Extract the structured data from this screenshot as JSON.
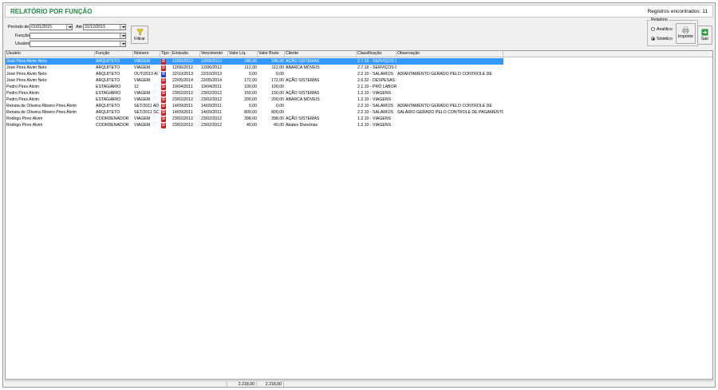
{
  "header": {
    "title": "RELATÓRIO POR FUNÇÃO",
    "records_found": "Registros encontrados: 11"
  },
  "filters": {
    "period_label": "Período de",
    "date_from": "01/01/2015",
    "until_label": "Até",
    "date_to": "31/12/2015",
    "function_label": "Função",
    "function_value": "",
    "user_label": "Usuário",
    "user_value": "",
    "filter_button": "Filtrar"
  },
  "report": {
    "legend": "Relatório",
    "options": [
      "Analítico",
      "Sintético"
    ],
    "selected": "Sintético",
    "print_button": "Imprimir",
    "exit_button": "Sair"
  },
  "colors": {
    "title_green": "#1e8a3e",
    "selection_blue": "#3399ff",
    "type_d": "#cc1f1f",
    "type_r": "#1f3fcc"
  },
  "table": {
    "columns": [
      "Usuário",
      "Função",
      "Número",
      "Tipo",
      "Emissão",
      "Vencimento",
      "Valor Líq.",
      "Valor Bruto",
      "Cliente",
      "Classificação",
      "Observação"
    ],
    "sort_indicator": "/",
    "rows": [
      {
        "usuario": "José Pires Alvim Neto",
        "funcao": "ARQUITETO",
        "numero": "VIAGEM",
        "tipo": "D",
        "emissao": "12/06/2012",
        "vencimento": "12/06/2012",
        "liq": "246,00",
        "bruto": "246,00",
        "cliente": "AÇÃO SISTEMAS",
        "classificacao": "2.7.16 - SERVIÇOS D",
        "observacao": "",
        "selected": true
      },
      {
        "usuario": "José Pires Alvim Neto",
        "funcao": "ARQUITETO",
        "numero": "VIAGEM",
        "tipo": "D",
        "emissao": "12/06/2012",
        "vencimento": "12/06/2012",
        "liq": "112,00",
        "bruto": "112,00",
        "cliente": "ABARCA MÓVEIS",
        "classificacao": "2.7.16 - SERVIÇOS D",
        "observacao": "",
        "selected": false
      },
      {
        "usuario": "José Pires Alvim Neto",
        "funcao": "ARQUITETO",
        "numero": "OUT/2013 Al",
        "tipo": "R",
        "emissao": "22/10/2013",
        "vencimento": "22/10/2013",
        "liq": "0,00",
        "bruto": "0,00",
        "cliente": "",
        "classificacao": "2.2.10 - SALÁRIOS",
        "observacao": "ADIANTAMENTO GERADO PELO CONTROLE DE",
        "selected": false
      },
      {
        "usuario": "José Pires Alvim Neto",
        "funcao": "ARQUITETO",
        "numero": "VIAGEM",
        "tipo": "D",
        "emissao": "22/05/2014",
        "vencimento": "22/05/2014",
        "liq": "172,00",
        "bruto": "172,00",
        "cliente": "AÇÃO SISTEMAS",
        "classificacao": "2.6.32 - DESPESAS C",
        "observacao": "",
        "selected": false
      },
      {
        "usuario": "Pedro Pires Alvim",
        "funcao": "ESTAGIÁRIO",
        "numero": "12",
        "tipo": "D",
        "emissao": "19/04/2011",
        "vencimento": "19/04/2011",
        "liq": "100,00",
        "bruto": "100,00",
        "cliente": "",
        "classificacao": "2.1.10 - PRÓ LABORE",
        "observacao": "",
        "selected": false
      },
      {
        "usuario": "Pedro Pires Alvim",
        "funcao": "ESTAGIÁRIO",
        "numero": "VIAGEM",
        "tipo": "D",
        "emissao": "23/02/2012",
        "vencimento": "23/02/2012",
        "liq": "150,00",
        "bruto": "150,00",
        "cliente": "AÇÃO SISTEMAS",
        "classificacao": "1.2.10 - VIAGENS",
        "observacao": "",
        "selected": false
      },
      {
        "usuario": "Pedro Pires Alvim",
        "funcao": "ESTAGIÁRIO",
        "numero": "VIAGEM",
        "tipo": "D",
        "emissao": "23/02/2012",
        "vencimento": "23/02/2012",
        "liq": "200,00",
        "bruto": "200,00",
        "cliente": "ABARCA MÓVEIS",
        "classificacao": "1.2.10 - VIAGENS",
        "observacao": "",
        "selected": false
      },
      {
        "usuario": "Renata de Oliveira Ribeiro Pires Alvim",
        "funcao": "ARQUITETO",
        "numero": "SET/2011 AD",
        "tipo": "D",
        "emissao": "14/09/2011",
        "vencimento": "14/09/2011",
        "liq": "0,00",
        "bruto": "0,00",
        "cliente": "",
        "classificacao": "2.2.10 - SALÁRIOS",
        "observacao": "ADIANTAMENTO GERADO PELO CONTROLE DE",
        "selected": false
      },
      {
        "usuario": "Renata de Oliveira Ribeiro Pires Alvim",
        "funcao": "ARQUITETO",
        "numero": "SET/2011 SC",
        "tipo": "D",
        "emissao": "14/09/2011",
        "vencimento": "14/09/2011",
        "liq": "800,00",
        "bruto": "800,00",
        "cliente": "",
        "classificacao": "2.2.10 - SALÁRIOS",
        "observacao": "SALÁRIO GERADO PELO CONTROLE DE PAGAMENTO",
        "selected": false
      },
      {
        "usuario": "Rodrigo Pires Alvim",
        "funcao": "COORDENADOR",
        "numero": "VIAGEM",
        "tipo": "D",
        "emissao": "23/02/2012",
        "vencimento": "23/02/2012",
        "liq": "398,00",
        "bruto": "398,00",
        "cliente": "AÇÃO SISTEMAS",
        "classificacao": "1.2.10 - VIAGENS",
        "observacao": "",
        "selected": false
      },
      {
        "usuario": "Rodrigo Pires Alvim",
        "funcao": "COORDENADOR",
        "numero": "VIAGEM",
        "tipo": "D",
        "emissao": "23/02/2012",
        "vencimento": "23/02/2012",
        "liq": "40,00",
        "bruto": "40,00",
        "cliente": "Abatex Divisórias",
        "classificacao": "1.2.10 - VIAGENS",
        "observacao": "",
        "selected": false
      }
    ]
  },
  "totals": {
    "liq": "2.218,00",
    "bruto": "2.218,00"
  }
}
